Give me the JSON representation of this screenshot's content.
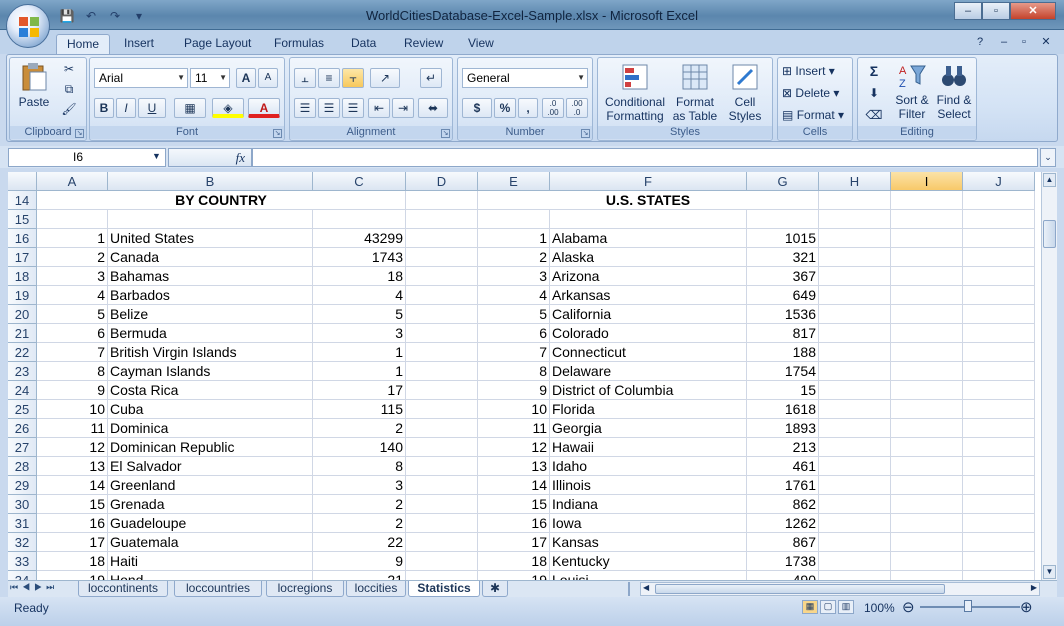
{
  "window": {
    "title": "WorldCitiesDatabase-Excel-Sample.xlsx - Microsoft Excel",
    "minimize": "–",
    "restore": "▫",
    "close": "✕"
  },
  "ribbon_tabs": [
    "Home",
    "Insert",
    "Page Layout",
    "Formulas",
    "Data",
    "Review",
    "View"
  ],
  "clipboard": {
    "label": "Clipboard",
    "paste": "Paste"
  },
  "font": {
    "label": "Font",
    "name": "Arial",
    "size": "11",
    "grow": "A",
    "shrink": "A",
    "bold": "B",
    "italic": "I",
    "underline": "U",
    "color_letter": "A"
  },
  "alignment": {
    "label": "Alignment"
  },
  "number": {
    "label": "Number",
    "format": "General",
    "currency": "$",
    "percent": "%",
    "comma": ",",
    "inc_decimal": ".0\n.00",
    "dec_decimal": ".00\n.0"
  },
  "styles": {
    "label": "Styles",
    "conditional": "Conditional\nFormatting",
    "format_table": "Format\nas Table",
    "cell_styles": "Cell\nStyles"
  },
  "cells": {
    "label": "Cells",
    "insert": "Insert",
    "delete": "Delete",
    "format": "Format"
  },
  "editing": {
    "label": "Editing",
    "sigma": "Σ",
    "sort": "Sort &\nFilter",
    "find": "Find &\nSelect"
  },
  "formula_bar": {
    "name_box": "I6",
    "fx": "fx",
    "value": ""
  },
  "columns": [
    "A",
    "B",
    "C",
    "D",
    "E",
    "F",
    "G",
    "H",
    "I",
    "J"
  ],
  "selected_column": "I",
  "rows": [
    "14",
    "15",
    "16",
    "17",
    "18",
    "19",
    "20",
    "21",
    "22",
    "23",
    "24",
    "25",
    "26",
    "27",
    "28",
    "29",
    "30",
    "31",
    "32",
    "33",
    "34"
  ],
  "headers": {
    "by_country": "BY COUNTRY",
    "us_states": "U.S. STATES"
  },
  "countries": [
    [
      "1",
      "United States",
      "43299"
    ],
    [
      "2",
      "Canada",
      "1743"
    ],
    [
      "3",
      "Bahamas",
      "18"
    ],
    [
      "4",
      "Barbados",
      "4"
    ],
    [
      "5",
      "Belize",
      "5"
    ],
    [
      "6",
      "Bermuda",
      "3"
    ],
    [
      "7",
      "British Virgin Islands",
      "1"
    ],
    [
      "8",
      "Cayman Islands",
      "1"
    ],
    [
      "9",
      "Costa Rica",
      "17"
    ],
    [
      "10",
      "Cuba",
      "115"
    ],
    [
      "11",
      "Dominica",
      "2"
    ],
    [
      "12",
      "Dominican Republic",
      "140"
    ],
    [
      "13",
      "El Salvador",
      "8"
    ],
    [
      "14",
      "Greenland",
      "3"
    ],
    [
      "15",
      "Grenada",
      "2"
    ],
    [
      "16",
      "Guadeloupe",
      "2"
    ],
    [
      "17",
      "Guatemala",
      "22"
    ],
    [
      "18",
      "Haiti",
      "9"
    ]
  ],
  "states": [
    [
      "1",
      "Alabama",
      "1015"
    ],
    [
      "2",
      "Alaska",
      "321"
    ],
    [
      "3",
      "Arizona",
      "367"
    ],
    [
      "4",
      "Arkansas",
      "649"
    ],
    [
      "5",
      "California",
      "1536"
    ],
    [
      "6",
      "Colorado",
      "817"
    ],
    [
      "7",
      "Connecticut",
      "188"
    ],
    [
      "8",
      "Delaware",
      "1754"
    ],
    [
      "9",
      "District of Columbia",
      "15"
    ],
    [
      "10",
      "Florida",
      "1618"
    ],
    [
      "11",
      "Georgia",
      "1893"
    ],
    [
      "12",
      "Hawaii",
      "213"
    ],
    [
      "13",
      "Idaho",
      "461"
    ],
    [
      "14",
      "Illinois",
      "1761"
    ],
    [
      "15",
      "Indiana",
      "862"
    ],
    [
      "16",
      "Iowa",
      "1262"
    ],
    [
      "17",
      "Kansas",
      "867"
    ],
    [
      "18",
      "Kentucky",
      "1738"
    ]
  ],
  "partial_row": {
    "a": "19",
    "b": "Hond",
    "c": "21",
    "e": "19",
    "f": "Louisi",
    "g": "490"
  },
  "sheet_tabs": [
    "loccontinents",
    "loccountries",
    "locregions",
    "loccities",
    "Statistics"
  ],
  "active_sheet": "Statistics",
  "status": {
    "ready": "Ready",
    "zoom": "100%",
    "zoom_out": "⊖",
    "zoom_in": "⊕"
  }
}
